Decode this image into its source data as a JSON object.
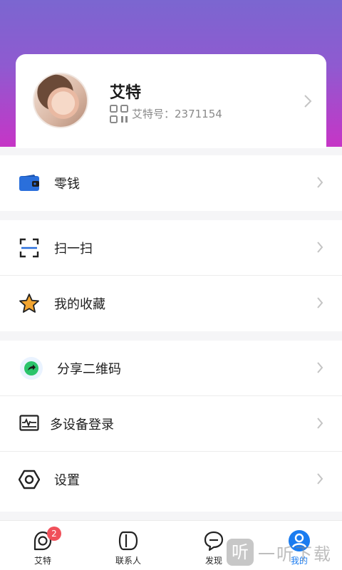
{
  "profile": {
    "name": "艾特",
    "id_text": "艾特号：2371154"
  },
  "menu": {
    "wallet": "零钱",
    "scan": "扫一扫",
    "favorites": "我的收藏",
    "share_qr": "分享二维码",
    "multi_device": "多设备登录",
    "settings": "设置"
  },
  "tabbar": {
    "tabs": [
      {
        "label": "艾特",
        "badge": "2"
      },
      {
        "label": "联系人"
      },
      {
        "label": "发现"
      },
      {
        "label": "我的"
      }
    ],
    "active_index": 3
  },
  "watermark": {
    "glyph": "听",
    "text": "一听下载"
  },
  "colors": {
    "header_gradient_top": "#7b66d0",
    "header_gradient_bottom": "#c635c6",
    "active_tab": "#1a7cf0",
    "badge": "#f0505a",
    "wallet_icon": "#2a6fdb",
    "star_icon": "#f3a530",
    "share_icon": "#2bc46b"
  },
  "icons": {
    "wallet": "wallet-icon",
    "scan": "scan-icon",
    "favorites": "star-icon",
    "share_qr": "share-icon",
    "multi_device": "monitor-icon",
    "settings": "hexagon-gear-icon",
    "qr": "qr-code-icon"
  }
}
